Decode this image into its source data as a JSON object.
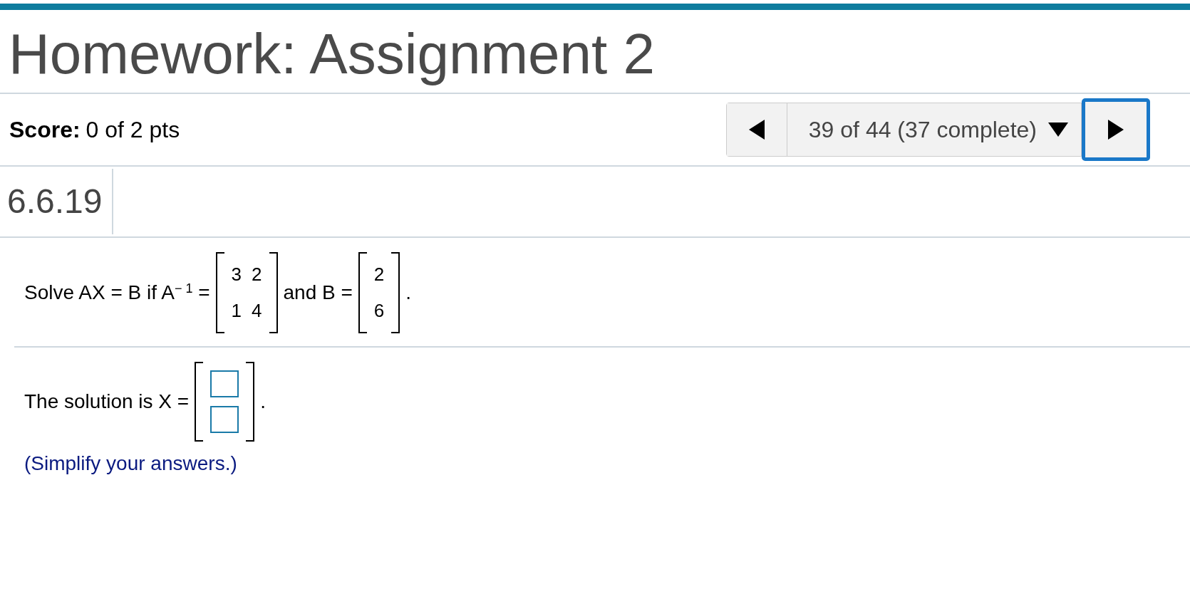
{
  "header": {
    "title": "Homework: Assignment 2"
  },
  "score": {
    "label": "Score:",
    "value": "0 of 2 pts"
  },
  "navigator": {
    "position": "39 of 44 (37 complete)",
    "next_focused": true
  },
  "problem_number": "6.6.19",
  "question": {
    "prefix": "Solve AX = B if A$^{− 1}$ =",
    "matrix_a": [
      [
        "3",
        "2"
      ],
      [
        "1",
        "4"
      ]
    ],
    "conjunction": "and B =",
    "matrix_b": [
      [
        "2"
      ],
      [
        "6"
      ]
    ],
    "suffix": "."
  },
  "answer": {
    "prefix": "The solution is X =",
    "fields": [
      {
        "kind": "number-box"
      },
      {
        "kind": "number-box"
      }
    ],
    "suffix": ".",
    "hint": "(Simplify your answers.)"
  }
}
